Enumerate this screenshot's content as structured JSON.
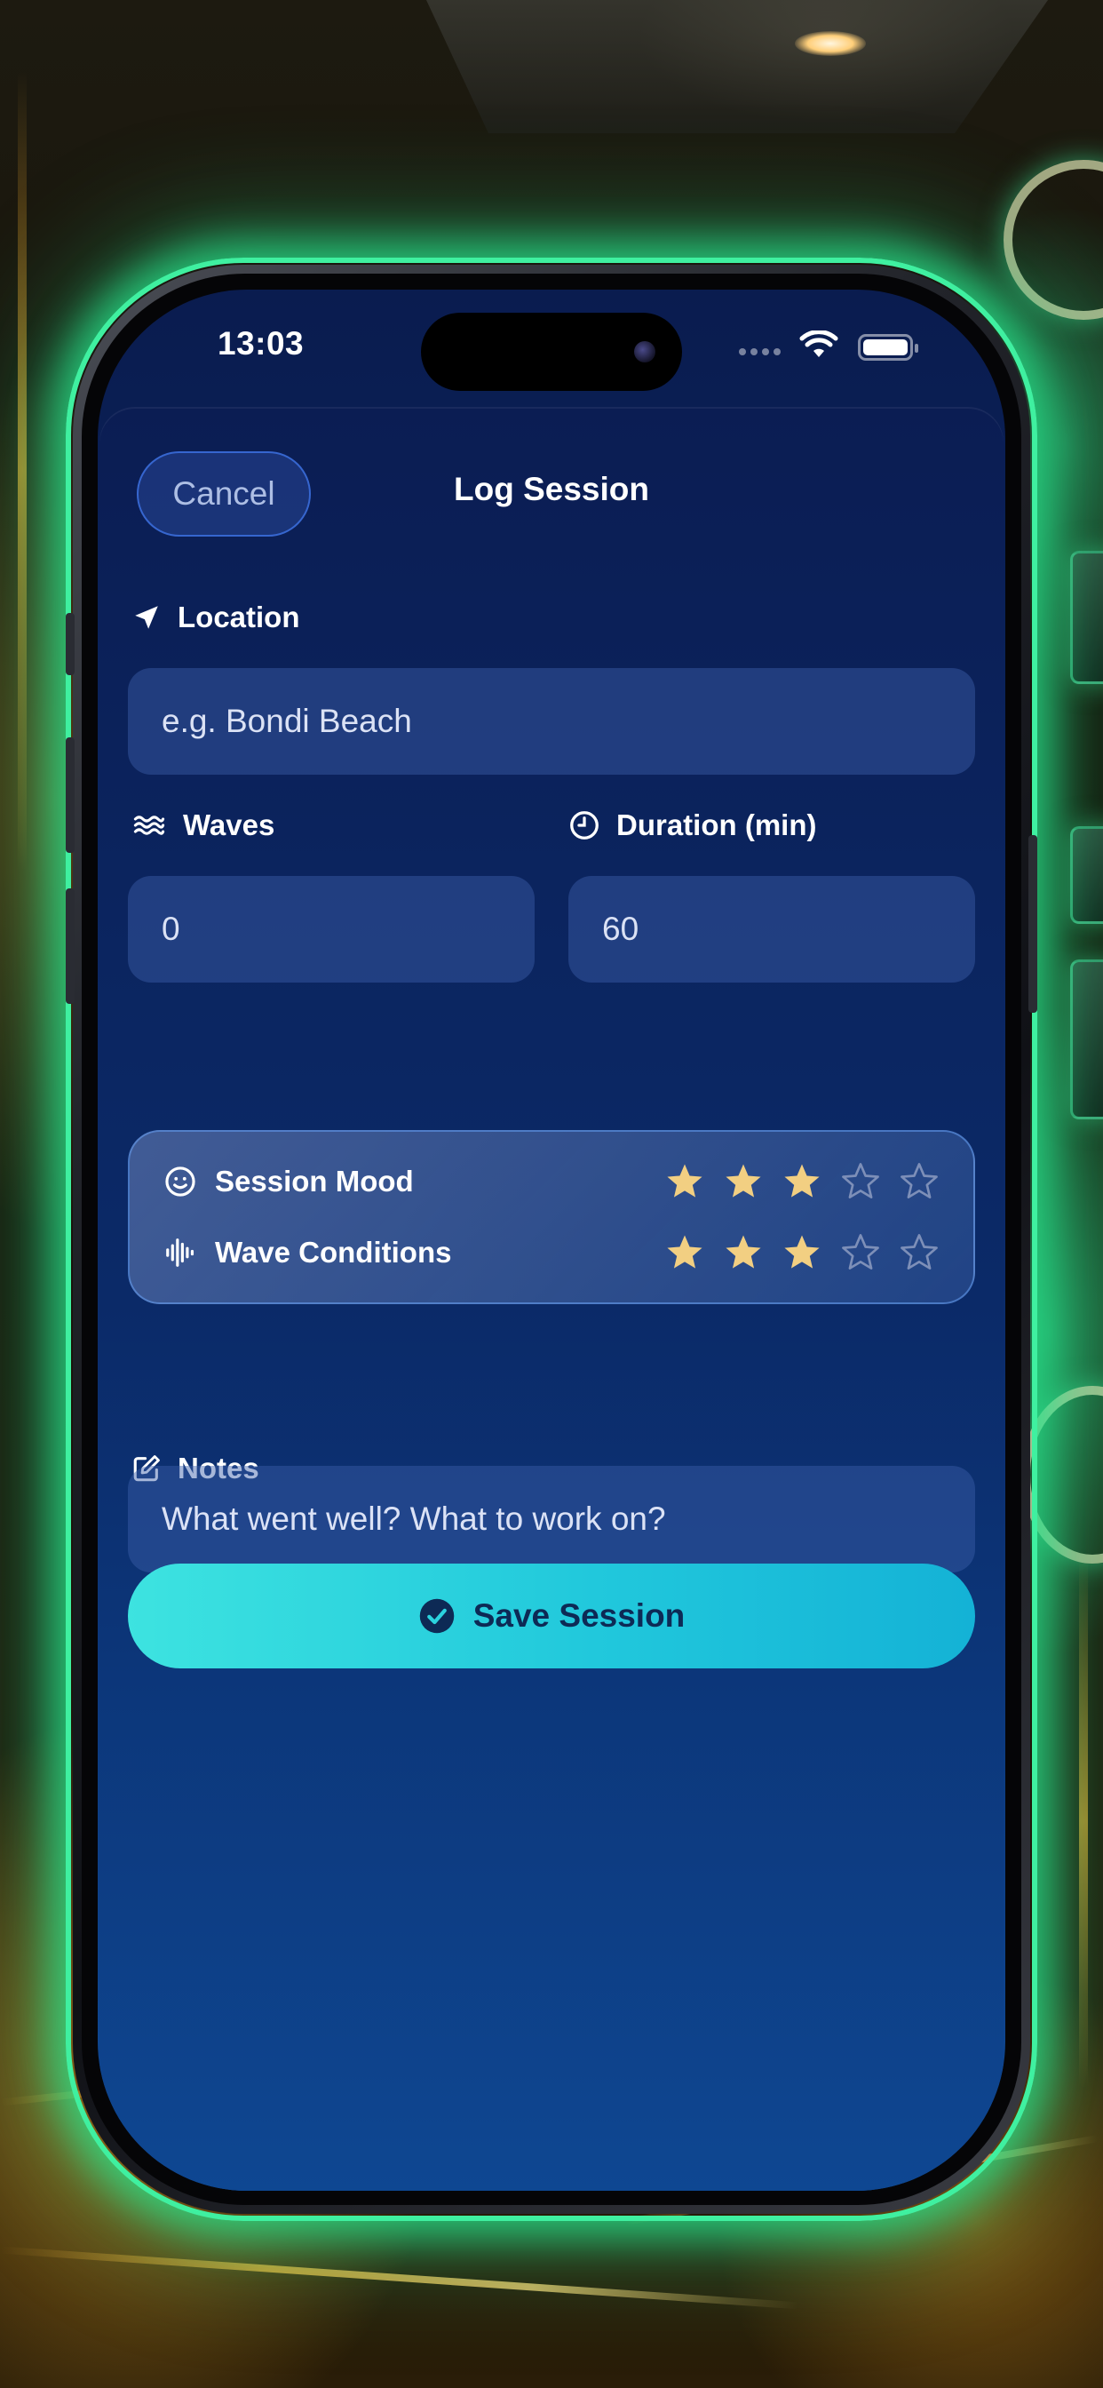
{
  "status_bar": {
    "time": "13:03"
  },
  "header": {
    "cancel_label": "Cancel",
    "title": "Log Session"
  },
  "form": {
    "location": {
      "label": "Location",
      "placeholder": "e.g. Bondi Beach"
    },
    "waves": {
      "label": "Waves",
      "value": "0"
    },
    "duration": {
      "label": "Duration (min)",
      "value": "60"
    },
    "ratings": [
      {
        "label": "Session Mood",
        "icon": "smiley-icon",
        "value": 3,
        "max": 5
      },
      {
        "label": "Wave Conditions",
        "icon": "waveform-icon",
        "value": 3,
        "max": 5
      }
    ],
    "notes": {
      "label": "Notes",
      "placeholder": "What went well? What to work on?"
    }
  },
  "save_button": {
    "label": "Save Session",
    "icon": "checkmark-circle-icon"
  },
  "colors": {
    "star_filled": "#f2cf82",
    "star_empty": "#7d8fb8",
    "accent": "#2bd3de",
    "phone_glow": "#3ff0a0"
  }
}
